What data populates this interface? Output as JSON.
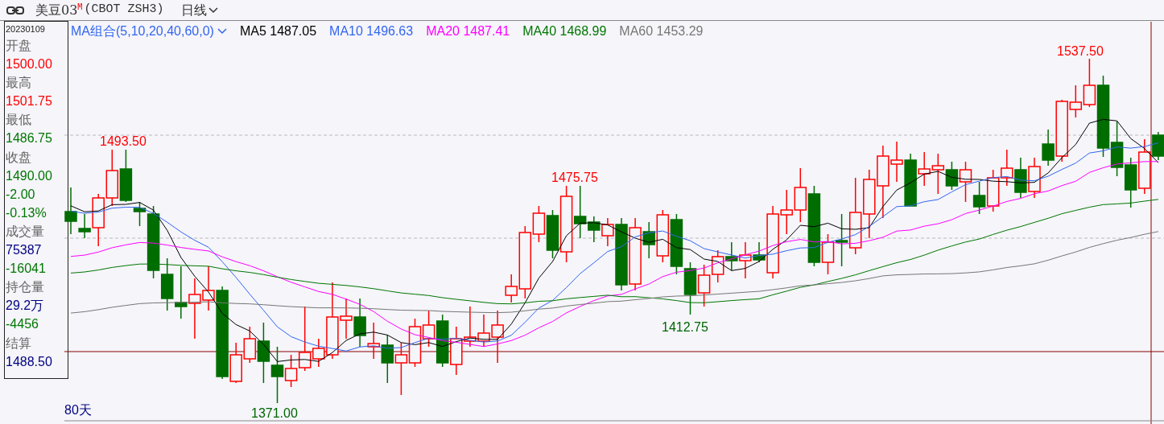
{
  "header": {
    "name": "美豆03",
    "badge": "M",
    "code": "(CBOT ZSH3)",
    "period": "日线"
  },
  "info_panel": {
    "date": "20230109",
    "rows": [
      {
        "text": "开盘",
        "color": "#666666"
      },
      {
        "text": "1500.00",
        "color": "#ff0000"
      },
      {
        "text": "最高",
        "color": "#666666"
      },
      {
        "text": "1501.75",
        "color": "#ff0000"
      },
      {
        "text": "最低",
        "color": "#666666"
      },
      {
        "text": "1486.75",
        "color": "#007700"
      },
      {
        "text": "收盘",
        "color": "#666666"
      },
      {
        "text": "1490.00",
        "color": "#007700"
      },
      {
        "text": "-2.00",
        "color": "#007700"
      },
      {
        "text": "-0.13%",
        "color": "#007700"
      },
      {
        "text": "成交量",
        "color": "#666666"
      },
      {
        "text": "75387",
        "color": "#000080"
      },
      {
        "text": "-16041",
        "color": "#007700"
      },
      {
        "text": "持仓量",
        "color": "#666666"
      },
      {
        "text": "29.2万",
        "color": "#000080"
      },
      {
        "text": "-4456",
        "color": "#007700"
      },
      {
        "text": "结算",
        "color": "#666666"
      },
      {
        "text": "1488.50",
        "color": "#000080"
      }
    ]
  },
  "legend": {
    "group": "MA组合(5,10,20,40,60,0)",
    "items": [
      {
        "name": "MA5",
        "value": "1487.05",
        "color": "#000000"
      },
      {
        "name": "MA10",
        "value": "1496.63",
        "color": "#3366ee"
      },
      {
        "name": "MA20",
        "value": "1487.41",
        "color": "#ff00ff"
      },
      {
        "name": "MA40",
        "value": "1468.99",
        "color": "#007700"
      },
      {
        "name": "MA60",
        "value": "1453.29",
        "color": "#777777"
      }
    ]
  },
  "price_marks": [
    {
      "text": "1493.50",
      "kind": "high"
    },
    {
      "text": "1371.00",
      "kind": "low"
    },
    {
      "text": "1475.75",
      "kind": "high"
    },
    {
      "text": "1412.75",
      "kind": "low"
    },
    {
      "text": "1537.50",
      "kind": "high"
    }
  ],
  "range_label": "80天"
}
